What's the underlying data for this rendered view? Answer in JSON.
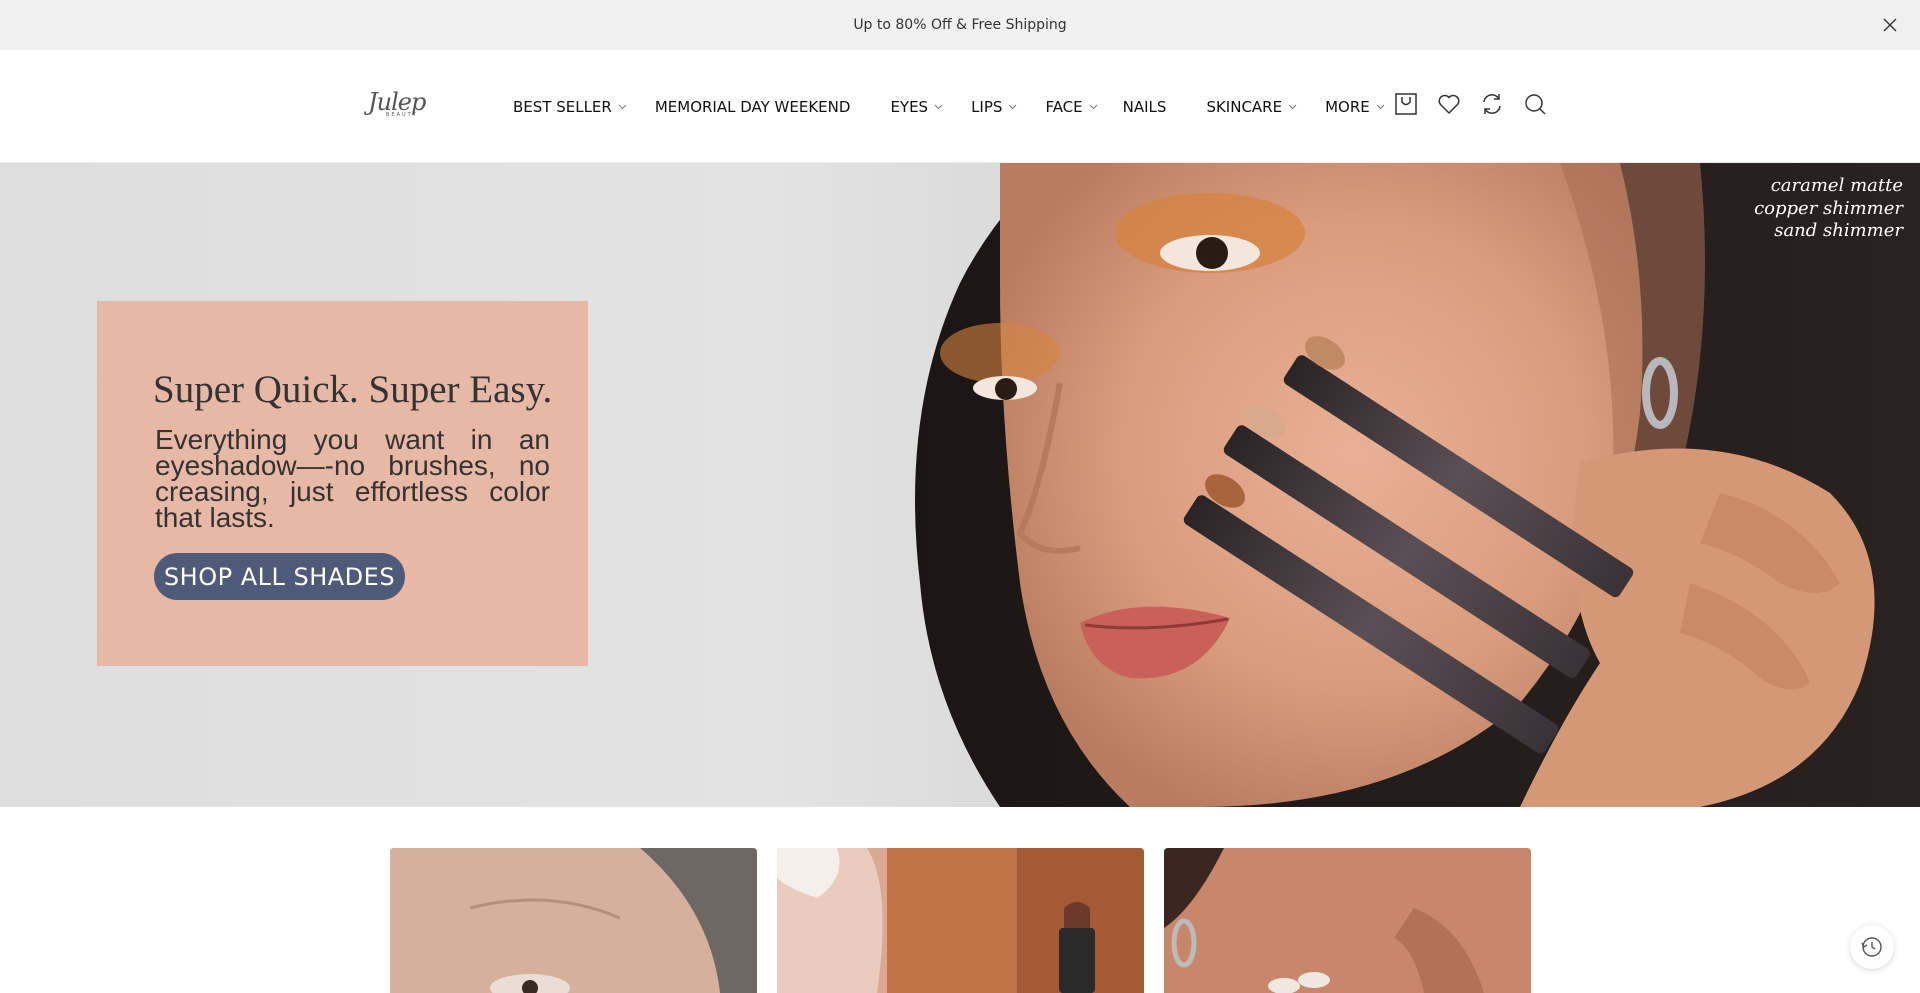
{
  "announcement": {
    "text": "Up to 80% Off & Free Shipping",
    "close_icon": "close-icon"
  },
  "brand": {
    "logo_word": "Julep",
    "logo_sub": "BEAUTY"
  },
  "nav": {
    "items": [
      {
        "label": "BEST SELLER",
        "has_dropdown": true
      },
      {
        "label": "MEMORIAL DAY WEEKEND",
        "has_dropdown": false
      },
      {
        "label": "EYES",
        "has_dropdown": true
      },
      {
        "label": "LIPS",
        "has_dropdown": true
      },
      {
        "label": "FACE",
        "has_dropdown": true
      },
      {
        "label": "NAILS",
        "has_dropdown": false
      },
      {
        "label": "SKINCARE",
        "has_dropdown": true
      },
      {
        "label": "MORE",
        "has_dropdown": true
      }
    ]
  },
  "header_icons": [
    "cart-icon",
    "heart-icon",
    "refresh-icon",
    "search-icon"
  ],
  "hero": {
    "shades": [
      "caramel matte",
      "copper shimmer",
      "sand shimmer"
    ],
    "title": "Super Quick. Super Easy.",
    "text": "Everything you want in an eyeshadow—-no brushes, no creasing, just effortless color that lasts.",
    "cta": "SHOP ALL SHADES",
    "box_color": "#e7b8a6",
    "cta_color": "#4d5a78"
  },
  "tiles": [
    "tile-portrait",
    "tile-swatches",
    "tile-skin"
  ],
  "history_icon": "history-icon"
}
